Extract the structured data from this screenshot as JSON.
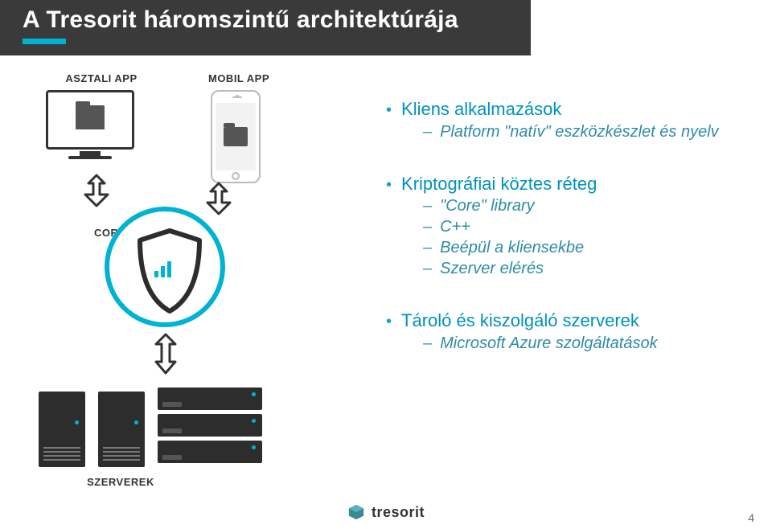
{
  "title": "A Tresorit háromszintű architektúrája",
  "labels": {
    "desktop_app": "ASZTALI APP",
    "mobile_app": "MOBIL APP",
    "core_lib": "CORE LIB",
    "servers": "SZERVEREK"
  },
  "bullets": [
    {
      "title": "Kliens alkalmazások",
      "subs": [
        "Platform \"natív\" eszközkészlet és nyelv"
      ]
    },
    {
      "title": "Kriptográfiai köztes réteg",
      "subs": [
        "\"Core\" library",
        "C++",
        "Beépül a kliensekbe",
        "Szerver elérés"
      ]
    },
    {
      "title": "Tároló és kiszolgáló szerverek",
      "subs": [
        "Microsoft Azure szolgáltatások"
      ]
    }
  ],
  "footer": {
    "brand": "tresorit",
    "page": "4"
  },
  "colors": {
    "accent": "#00b2d6",
    "text_accent": "#0092bb",
    "dark": "#2d2d2d"
  }
}
